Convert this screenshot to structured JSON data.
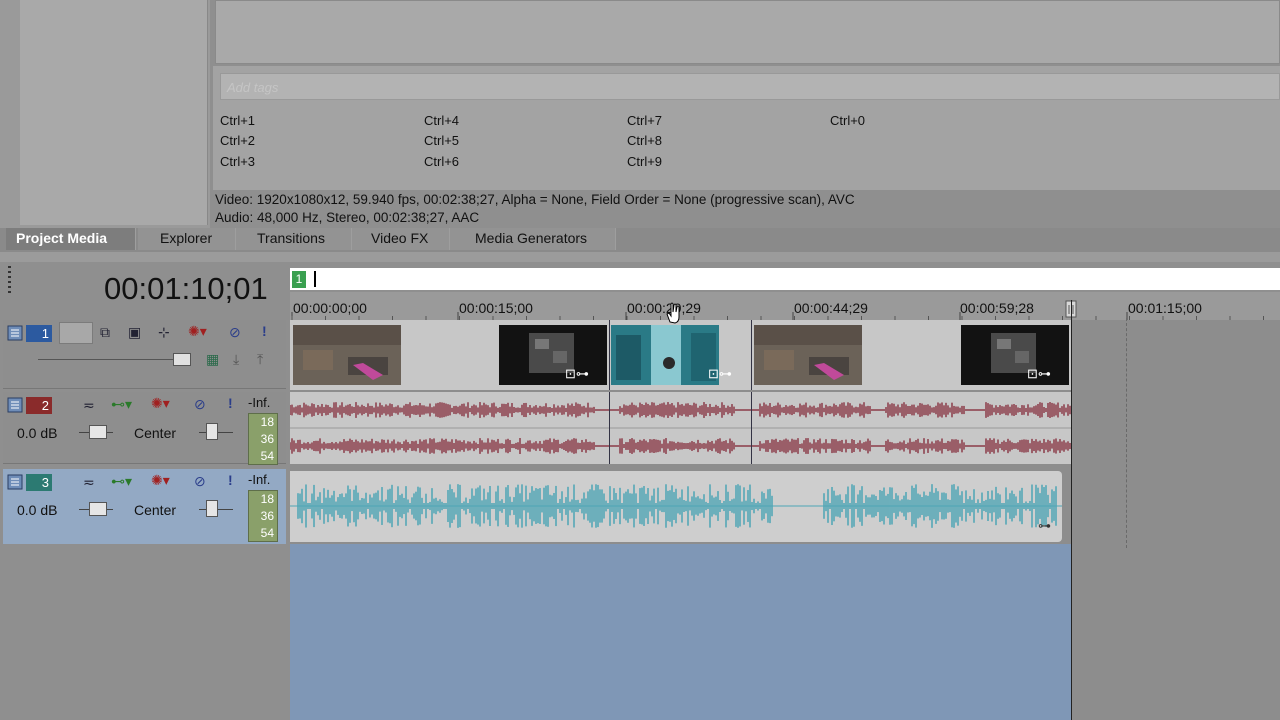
{
  "tags": {
    "placeholder": "Add tags",
    "shortcuts": [
      "Ctrl+1",
      "Ctrl+2",
      "Ctrl+3",
      "Ctrl+4",
      "Ctrl+5",
      "Ctrl+6",
      "Ctrl+7",
      "Ctrl+8",
      "Ctrl+9",
      "Ctrl+0"
    ]
  },
  "media_info": {
    "video": "Video: 1920x1080x12, 59.940 fps, 00:02:38;27, Alpha = None, Field Order = None (progressive scan), AVC",
    "audio": "Audio: 48,000 Hz, Stereo, 00:02:38;27, AAC"
  },
  "tabs": [
    "Project Media",
    "Explorer",
    "Transitions",
    "Video FX",
    "Media Generators"
  ],
  "active_tab": "Project Media",
  "timecode": "00:01:10;01",
  "marker": "1",
  "ruler": [
    "00:00:00;00",
    "00:00:15;00",
    "00:00:29;29",
    "00:00:44;29",
    "00:00:59;28",
    "00:01:15;00"
  ],
  "tracks": [
    {
      "number": "1",
      "type": "video",
      "color": "#2c5aa0"
    },
    {
      "number": "2",
      "type": "audio",
      "color": "#8a2b2b",
      "volume": "0.0 dB",
      "pan": "Center",
      "meter_top": "-Inf.",
      "meter": [
        "18",
        "36",
        "54"
      ]
    },
    {
      "number": "3",
      "type": "audio",
      "color": "#2c7a72",
      "volume": "0.0 dB",
      "pan": "Center",
      "meter_top": "-Inf.",
      "meter": [
        "18",
        "36",
        "54"
      ]
    }
  ],
  "colors": {
    "audio_wave_red": "#8b3a48",
    "audio_wave_teal": "#4da5b5",
    "selected_track": "#93a9c4"
  }
}
